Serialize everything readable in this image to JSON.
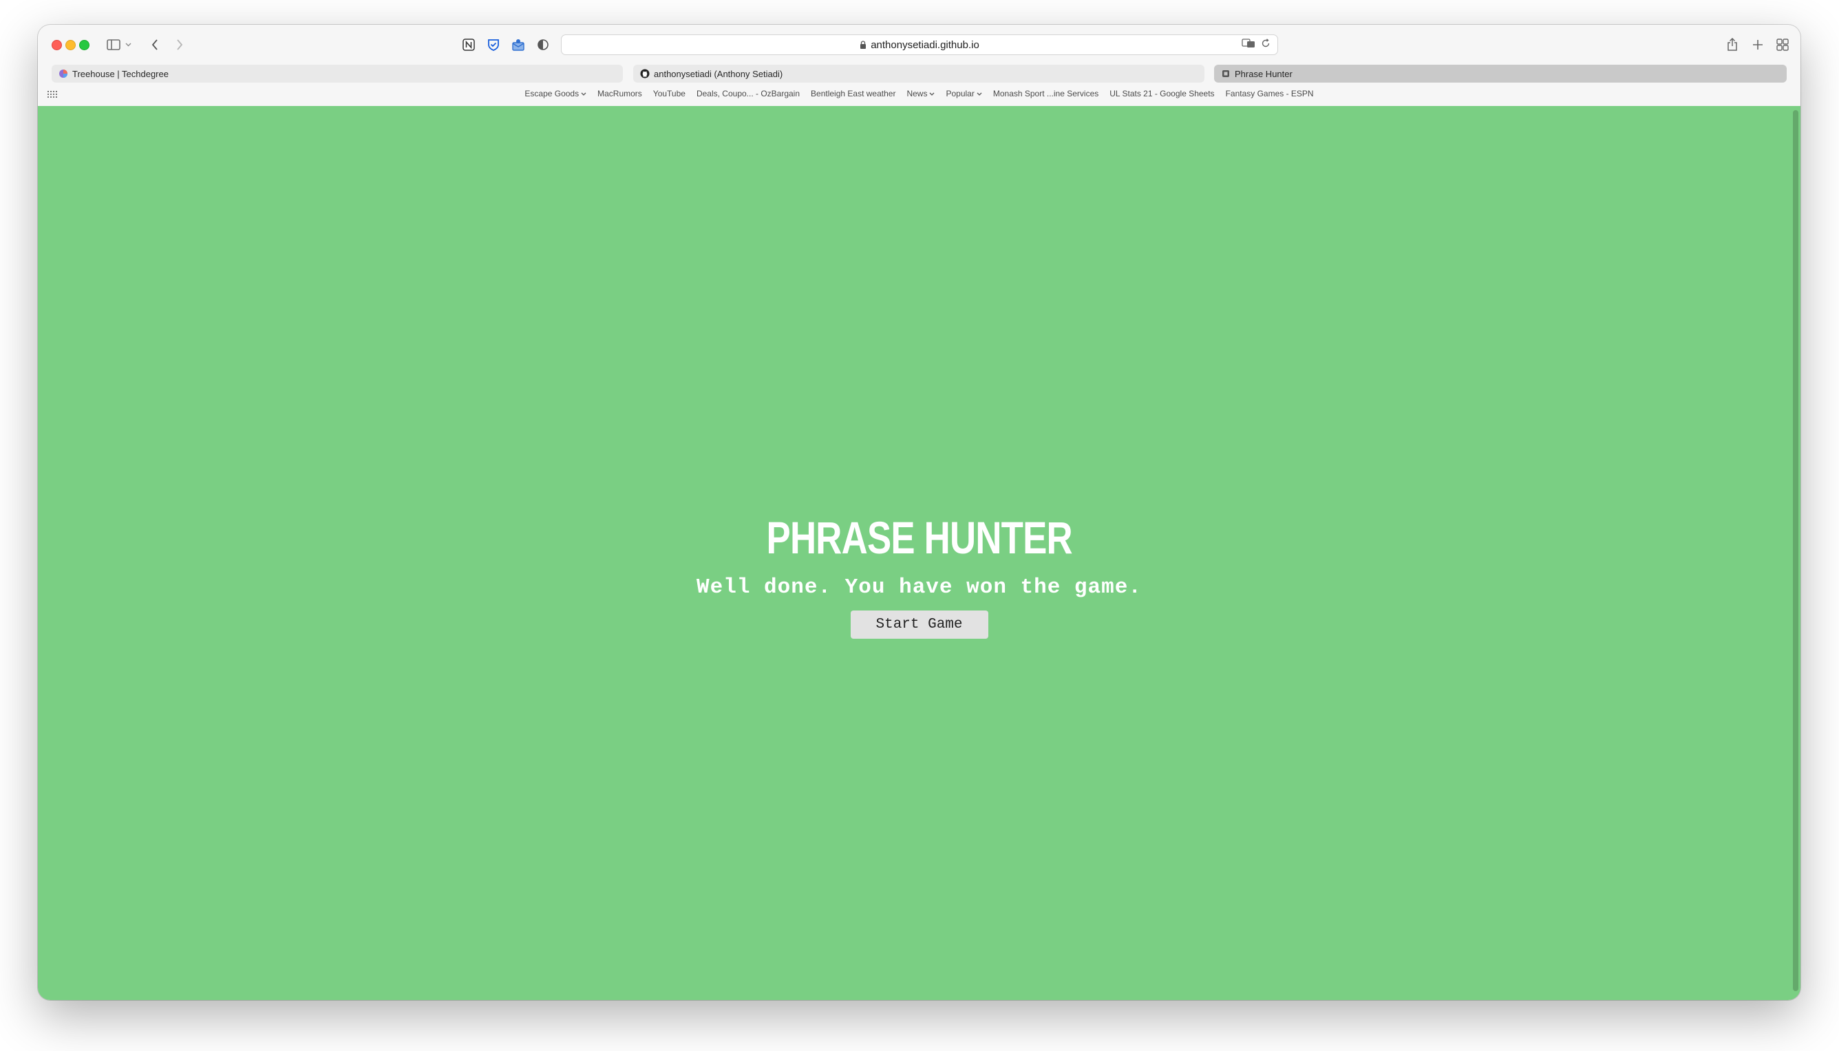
{
  "browser": {
    "url": "anthonysetiadi.github.io",
    "tabs": [
      {
        "title": "Treehouse | Techdegree",
        "active": false
      },
      {
        "title": "anthonysetiadi (Anthony Setiadi)",
        "active": false
      },
      {
        "title": "Phrase Hunter",
        "active": true
      }
    ],
    "favorites": [
      {
        "label": "Escape Goods",
        "dropdown": true
      },
      {
        "label": "MacRumors",
        "dropdown": false
      },
      {
        "label": "YouTube",
        "dropdown": false
      },
      {
        "label": "Deals, Coupo... - OzBargain",
        "dropdown": false
      },
      {
        "label": "Bentleigh East weather",
        "dropdown": false
      },
      {
        "label": "News",
        "dropdown": true
      },
      {
        "label": "Popular",
        "dropdown": true
      },
      {
        "label": "Monash Sport ...ine Services",
        "dropdown": false
      },
      {
        "label": "UL Stats 21 - Google Sheets",
        "dropdown": false
      },
      {
        "label": "Fantasy Games - ESPN",
        "dropdown": false
      }
    ]
  },
  "page": {
    "title": "PHRASE HUNTER",
    "message": "Well done. You have won the game.",
    "start_button": "Start Game",
    "background_color": "#7acf83"
  }
}
